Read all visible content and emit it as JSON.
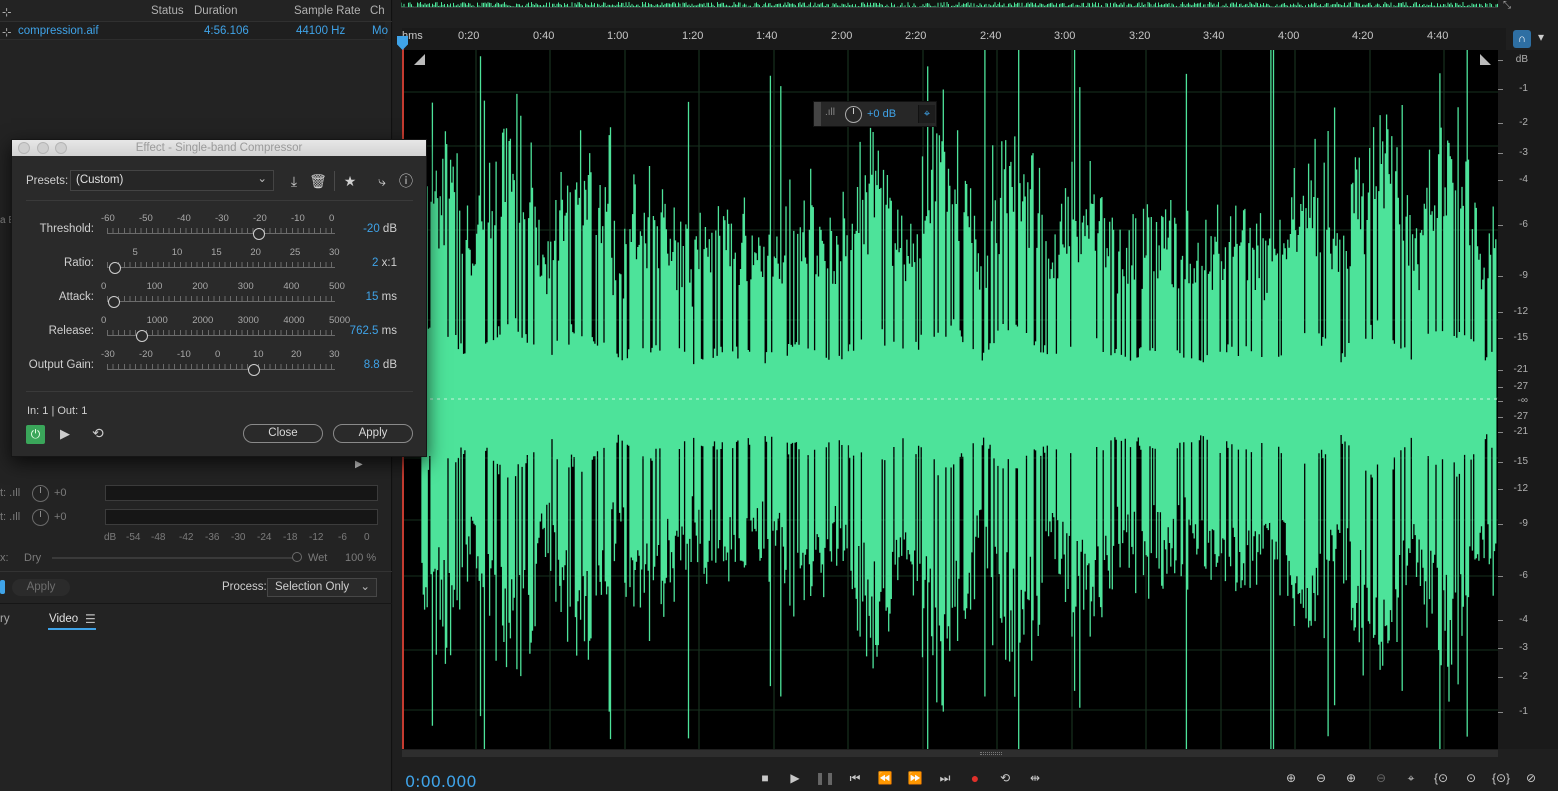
{
  "files_panel": {
    "columns": [
      "Status",
      "Duration",
      "Sample Rate",
      "Ch"
    ],
    "file": {
      "name": "compression.aif",
      "duration": "4:56.106",
      "sample_rate": "44100 Hz",
      "channels": "Mo"
    }
  },
  "dialog": {
    "title": "Effect - Single-band Compressor",
    "presets_label": "Presets:",
    "preset_value": "(Custom)",
    "toolbar_icons": [
      "download-icon",
      "trash-icon",
      "star-icon",
      "routing-icon",
      "info-icon"
    ],
    "sliders": [
      {
        "label": "Threshold:",
        "scale": [
          "-60",
          "-50",
          "-40",
          "-30",
          "-20",
          "-10",
          "0"
        ],
        "min": -60,
        "max": 0,
        "value": -20,
        "value_text": "-20",
        "unit": "dB"
      },
      {
        "label": "Ratio:",
        "scale": [
          "5",
          "10",
          "15",
          "20",
          "25",
          "30"
        ],
        "min": 1,
        "max": 30,
        "value": 2,
        "value_text": "2",
        "unit": "x:1"
      },
      {
        "label": "Attack:",
        "scale": [
          "0",
          "100",
          "200",
          "300",
          "400",
          "500"
        ],
        "min": 0,
        "max": 500,
        "value": 15,
        "value_text": "15",
        "unit": "ms"
      },
      {
        "label": "Release:",
        "scale": [
          "0",
          "1000",
          "2000",
          "3000",
          "4000",
          "5000"
        ],
        "min": 0,
        "max": 5000,
        "value": 762.5,
        "value_text": "762.5",
        "unit": "ms"
      },
      {
        "label": "Output Gain:",
        "scale": [
          "-30",
          "-20",
          "-10",
          "0",
          "10",
          "20",
          "30"
        ],
        "min": -30,
        "max": 30,
        "value": 8.8,
        "value_text": "8.8",
        "unit": "dB"
      }
    ],
    "io_text": "In: 1 | Out: 1",
    "close_label": "Close",
    "apply_label": "Apply"
  },
  "rack": {
    "input_gain": "+0",
    "output_gain": "+0",
    "meter_scale": [
      "dB",
      "-54",
      "-48",
      "-42",
      "-36",
      "-30",
      "-24",
      "-18",
      "-12",
      "-6",
      "0"
    ],
    "dry_label": "Dry",
    "wet_label": "Wet",
    "wet_value": "100 %",
    "apply_label": "Apply",
    "process_label": "Process:",
    "process_value": "Selection Only"
  },
  "bottom_tabs": [
    "Video"
  ],
  "timeline": {
    "ruler": [
      "hms",
      "0:20",
      "0:40",
      "1:00",
      "1:20",
      "1:40",
      "2:00",
      "2:20",
      "2:40",
      "3:00",
      "3:20",
      "3:40",
      "4:00",
      "4:20",
      "4:40"
    ],
    "db_scale": [
      "dB",
      "-1",
      "-2",
      "-3",
      "-4",
      "-6",
      "-9",
      "-12",
      "-15",
      "-21",
      "-27",
      "-∞",
      "-27",
      "-21",
      "-15",
      "-12",
      "-9",
      "-6",
      "-4",
      "-3",
      "-2",
      "-1"
    ],
    "hud_gain": "+0 dB",
    "current_time": "0:00.000",
    "waveform_color": "#4de39a"
  },
  "colors": {
    "accent": "#3fa3e8",
    "record": "#e0302a",
    "power": "#3aa65a"
  }
}
